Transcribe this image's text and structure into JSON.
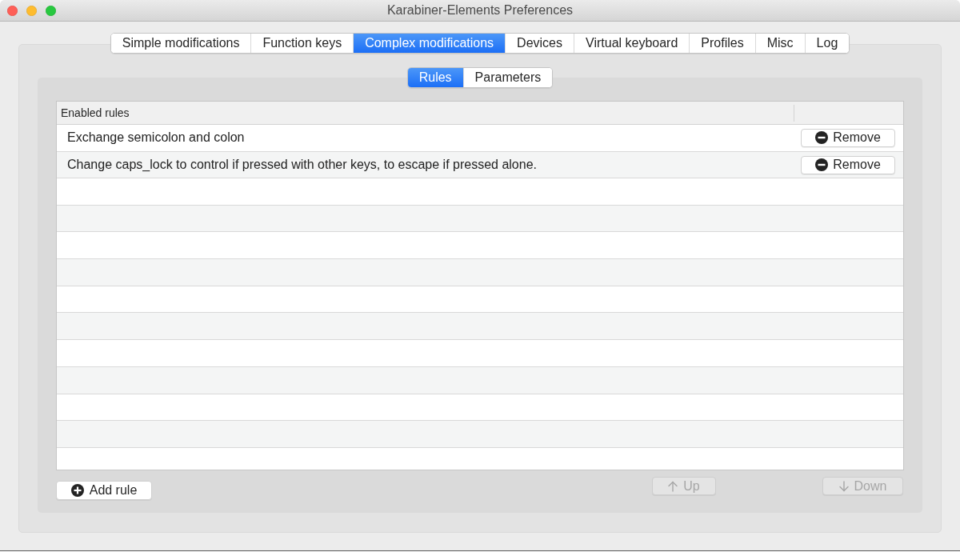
{
  "window": {
    "title": "Karabiner-Elements Preferences"
  },
  "tabs": [
    {
      "label": "Simple modifications",
      "selected": false
    },
    {
      "label": "Function keys",
      "selected": false
    },
    {
      "label": "Complex modifications",
      "selected": true
    },
    {
      "label": "Devices",
      "selected": false
    },
    {
      "label": "Virtual keyboard",
      "selected": false
    },
    {
      "label": "Profiles",
      "selected": false
    },
    {
      "label": "Misc",
      "selected": false
    },
    {
      "label": "Log",
      "selected": false
    }
  ],
  "subtabs": [
    {
      "label": "Rules",
      "selected": true
    },
    {
      "label": "Parameters",
      "selected": false
    }
  ],
  "rules_table": {
    "columns": [
      "Enabled rules"
    ],
    "rows": [
      {
        "description": "Exchange semicolon and colon",
        "button": "Remove"
      },
      {
        "description": "Change caps_lock to control if pressed with other keys, to escape if pressed alone.",
        "button": "Remove"
      }
    ]
  },
  "buttons": [
    {
      "kind": "add",
      "label": "Add rule",
      "disabled": false
    },
    {
      "kind": "up",
      "label": "Up",
      "disabled": true
    },
    {
      "kind": "down",
      "label": "Down",
      "disabled": true
    }
  ]
}
